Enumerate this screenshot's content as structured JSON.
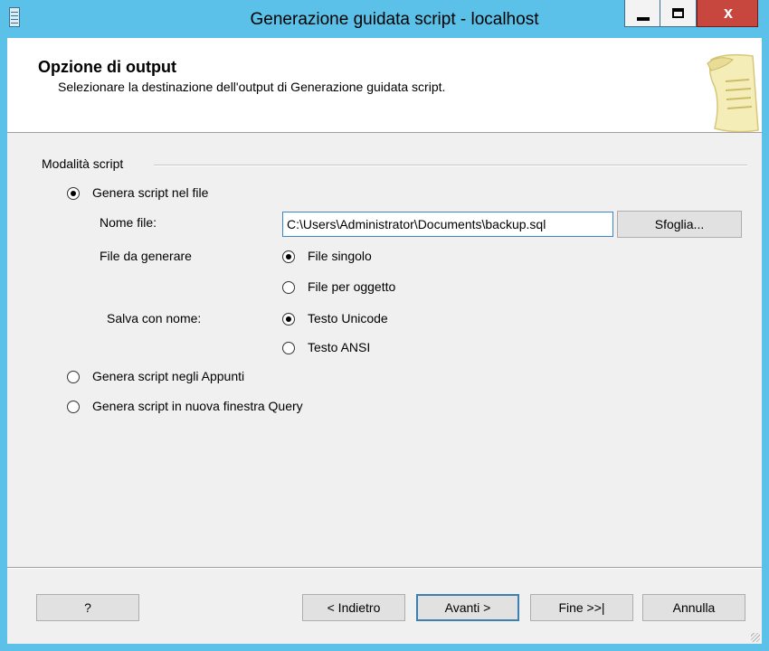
{
  "window": {
    "title": "Generazione guidata script - localhost"
  },
  "titlebar_buttons": {
    "minimize": "minimize-icon",
    "maximize": "maximize-icon",
    "close": "x"
  },
  "header": {
    "title": "Opzione di output",
    "subtitle": "Selezionare la destinazione dell'output di Generazione guidata script.",
    "icon": "scroll-document-icon"
  },
  "script_mode": {
    "group_label": "Modalità script",
    "option_file": {
      "label": "Genera script nel file",
      "selected": true
    },
    "file_name_label": "Nome file:",
    "file_name_value": "C:\\Users\\Administrator\\Documents\\backup.sql",
    "browse_label": "Sfoglia...",
    "files_to_generate_label": "File da generare",
    "single_file": {
      "label": "File singolo",
      "selected": true
    },
    "file_per_object": {
      "label": "File per oggetto",
      "selected": false
    },
    "save_as_label": "Salva con nome:",
    "unicode_text": {
      "label": "Testo Unicode",
      "selected": true
    },
    "ansi_text": {
      "label": "Testo ANSI",
      "selected": false
    },
    "option_clipboard": {
      "label": "Genera script negli Appunti",
      "selected": false
    },
    "option_query_window": {
      "label": "Genera script in nuova finestra Query",
      "selected": false
    }
  },
  "footer": {
    "help_label": "?",
    "back_label": "< Indietro",
    "next_label": "Avanti >",
    "finish_label": "Fine >>|",
    "cancel_label": "Annulla"
  },
  "colors": {
    "titlebar": "#5bc1e8",
    "close": "#c7463e",
    "dialog_bg": "#f0f0f0"
  }
}
